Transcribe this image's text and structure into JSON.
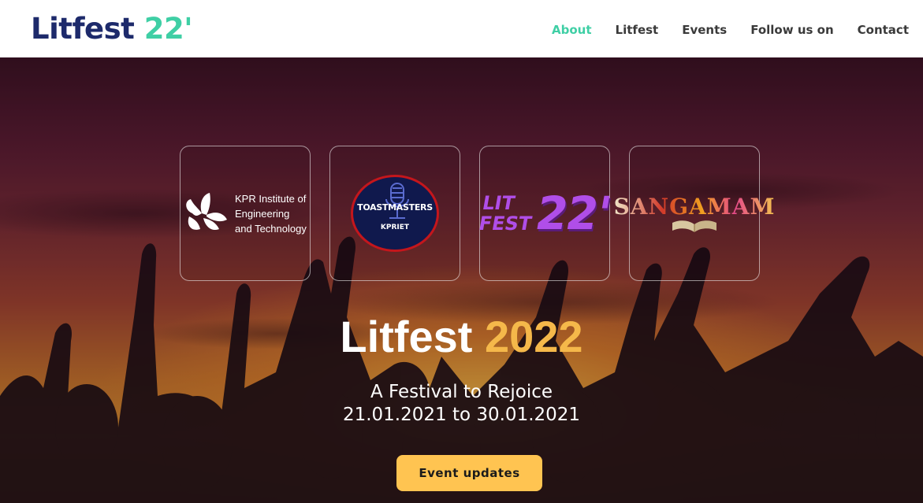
{
  "header": {
    "brand_main": "Litfest",
    "brand_accent": "22'",
    "nav": [
      {
        "label": "About",
        "active": true
      },
      {
        "label": "Litfest",
        "active": false
      },
      {
        "label": "Events",
        "active": false
      },
      {
        "label": "Follow us on",
        "active": false
      },
      {
        "label": "Contact",
        "active": false
      }
    ]
  },
  "logos": {
    "kpr": {
      "text": "KPR Institute of Engineering and Technology",
      "icon": "kpr-leaf-icon"
    },
    "toastmasters": {
      "word": "TOASTMASTERS",
      "sub": "KPRIET",
      "icon": "microphone-icon"
    },
    "litfest": {
      "line1": "LIT",
      "line2": "FEST",
      "big": "22'"
    },
    "sangamam": {
      "word": "SANGAMAM",
      "icon": "open-book-icon"
    }
  },
  "hero": {
    "title_main": "Litfest",
    "title_year": "2022",
    "tagline": "A Festival to Rejoice",
    "dates": "21.01.2021 to 30.01.2021",
    "button": "Event updates"
  },
  "colors": {
    "brand_navy": "#1d2a6b",
    "accent_teal": "#3fcfa5",
    "year_gold": "#f5b84a",
    "button_yellow": "#ffc451"
  }
}
